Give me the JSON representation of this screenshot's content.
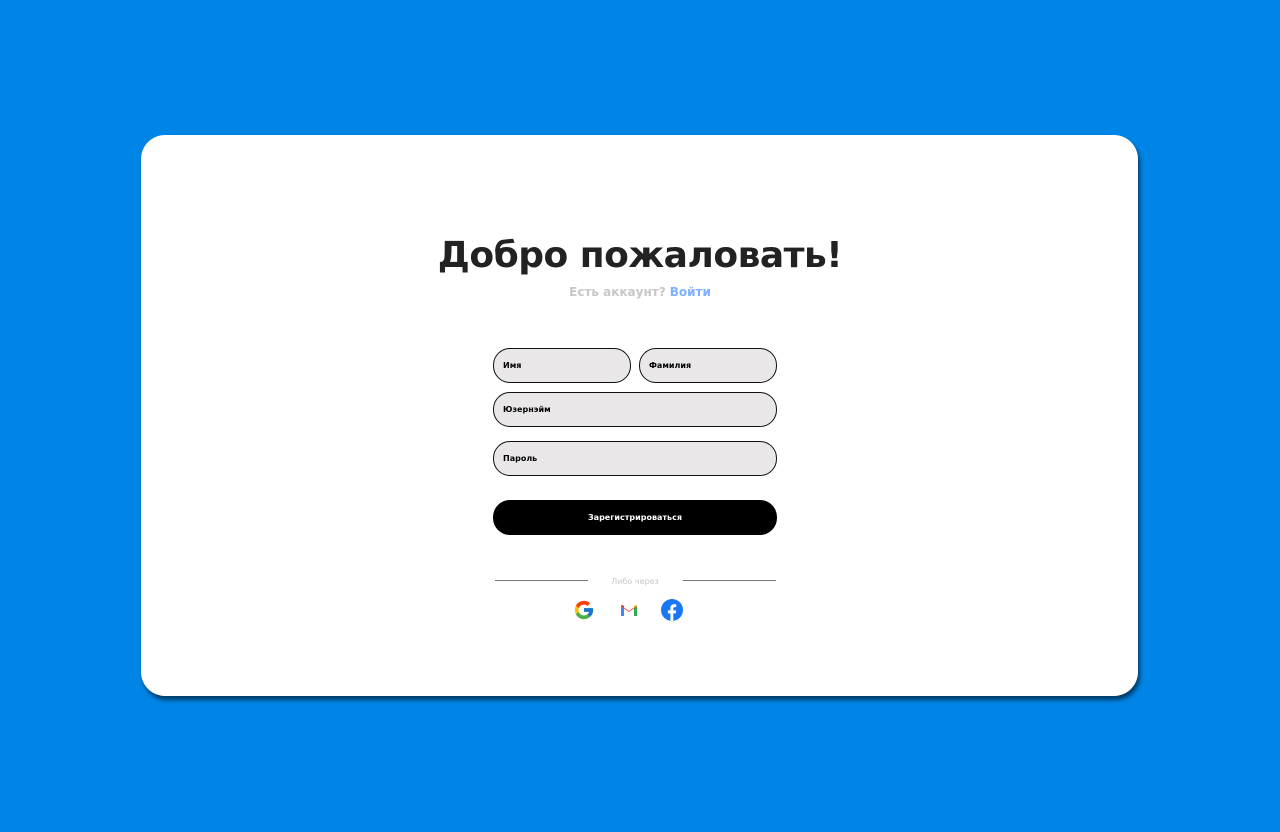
{
  "heading": "Добро пожаловать!",
  "subtitle": {
    "question": "Есть аккаунт?",
    "login_link": "Войти"
  },
  "form": {
    "first_name_placeholder": "Имя",
    "last_name_placeholder": "Фамилия",
    "username_placeholder": "Юзернэйм",
    "password_placeholder": "Пароль",
    "submit_label": "Зарегистрироваться"
  },
  "divider_text": "Либо через",
  "social": [
    {
      "icon": "google-icon"
    },
    {
      "icon": "gmail-icon"
    },
    {
      "icon": "facebook-icon"
    }
  ],
  "colors": {
    "background": "#0085e6",
    "card": "#ffffff",
    "input_fill": "#e9e7e7",
    "button": "#000000",
    "link": "#7fb0ff",
    "muted": "#c7c7c7"
  }
}
